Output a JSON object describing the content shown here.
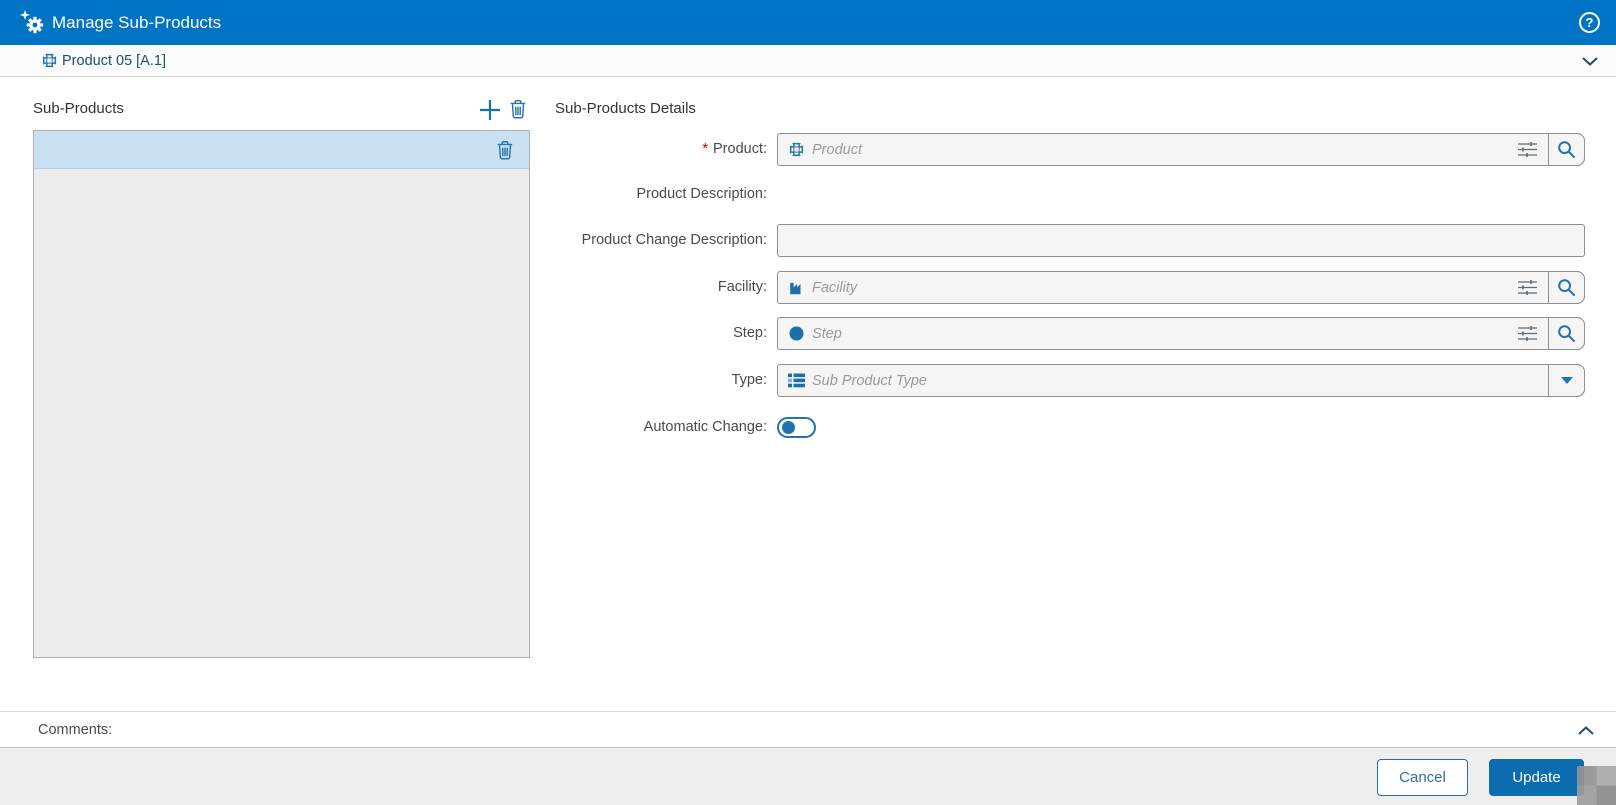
{
  "title_bar": {
    "title": "Manage Sub-Products",
    "help_glyph": "?"
  },
  "context_row": {
    "label": "Product 05 [A.1]"
  },
  "sub_products_panel": {
    "title": "Sub-Products",
    "rows": [
      {
        "selected": true,
        "label": ""
      }
    ]
  },
  "details_panel": {
    "title": "Sub-Products Details",
    "required_marker": "*",
    "product": {
      "label": "Product:",
      "required": true,
      "placeholder": "Product",
      "value": ""
    },
    "product_description": {
      "label": "Product Description:",
      "value": ""
    },
    "product_change_description": {
      "label": "Product Change Description:",
      "value": ""
    },
    "facility": {
      "label": "Facility:",
      "placeholder": "Facility",
      "value": ""
    },
    "step": {
      "label": "Step:",
      "placeholder": "Step",
      "value": ""
    },
    "type": {
      "label": "Type:",
      "placeholder": "Sub Product Type",
      "value": ""
    },
    "automatic_change": {
      "label": "Automatic Change:",
      "state": "off"
    }
  },
  "comments_section": {
    "label": "Comments:"
  },
  "footer": {
    "cancel": "Cancel",
    "update": "Update"
  },
  "icons": {
    "title": "gear-with-spark-icon",
    "help": "circled-question-icon",
    "product": "plus-outline-product-icon",
    "facility": "factory-icon",
    "step": "filled-circle-icon",
    "type": "list-icon",
    "add": "plus-icon",
    "delete": "trash-icon",
    "search": "magnifier-icon",
    "filter": "sliders-icon",
    "collapse": "chevron-up-icon",
    "expand": "chevron-down-icon"
  },
  "colors": {
    "titlebar_bg": "#0173c5",
    "accent_blue": "#2272b2",
    "link_text": "#1d4e79",
    "selected_row_bg": "#c9e0f2",
    "field_bg": "#f5f5f5",
    "field_border": "#8f8f8f",
    "update_button_bg": "#0b6cb0",
    "cancel_button_border": "#2e6da4",
    "footer_bg": "#efeeee",
    "required_marker": "#c00000"
  }
}
